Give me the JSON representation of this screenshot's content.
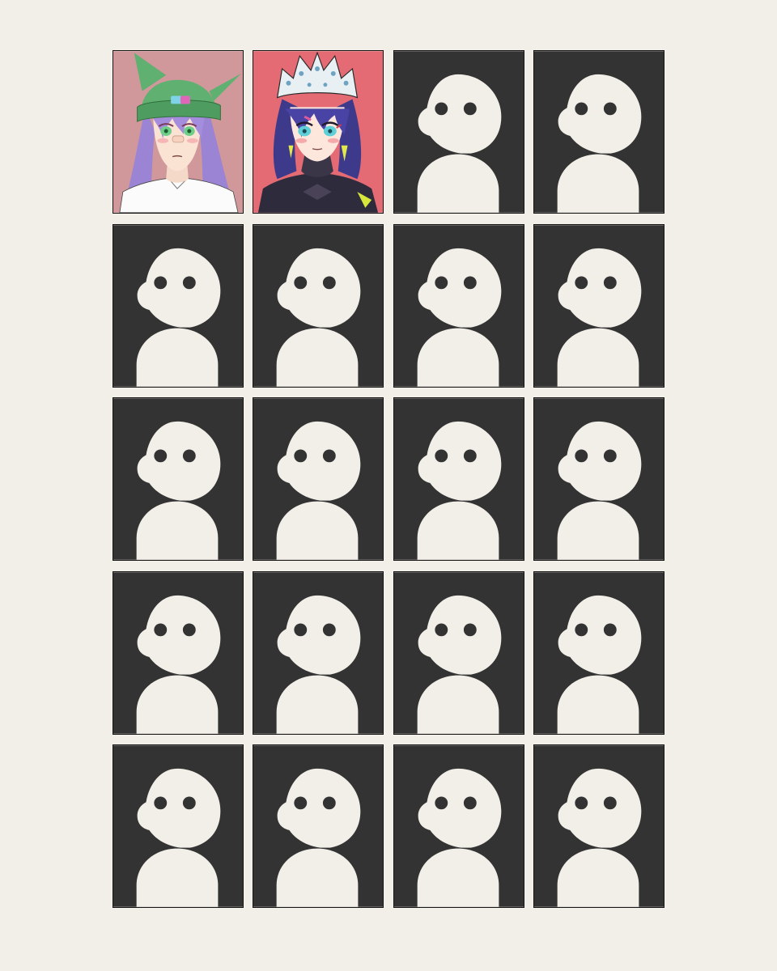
{
  "colors": {
    "background": "#f2efe9",
    "placeholder_bg": "#333333",
    "placeholder_figure": "#f2efe9",
    "placeholder_eyes": "#333333",
    "border": "#161616"
  },
  "grid": {
    "columns": 4,
    "rows": 5,
    "cells": [
      {
        "kind": "portrait",
        "variant": "green-hat-girl",
        "bg": "#d1989b"
      },
      {
        "kind": "portrait",
        "variant": "maid-headband-girl",
        "bg": "#e46a73"
      },
      {
        "kind": "placeholder"
      },
      {
        "kind": "placeholder"
      },
      {
        "kind": "placeholder"
      },
      {
        "kind": "placeholder"
      },
      {
        "kind": "placeholder"
      },
      {
        "kind": "placeholder"
      },
      {
        "kind": "placeholder"
      },
      {
        "kind": "placeholder"
      },
      {
        "kind": "placeholder"
      },
      {
        "kind": "placeholder"
      },
      {
        "kind": "placeholder"
      },
      {
        "kind": "placeholder"
      },
      {
        "kind": "placeholder"
      },
      {
        "kind": "placeholder"
      },
      {
        "kind": "placeholder"
      },
      {
        "kind": "placeholder"
      },
      {
        "kind": "placeholder"
      },
      {
        "kind": "placeholder"
      }
    ]
  }
}
